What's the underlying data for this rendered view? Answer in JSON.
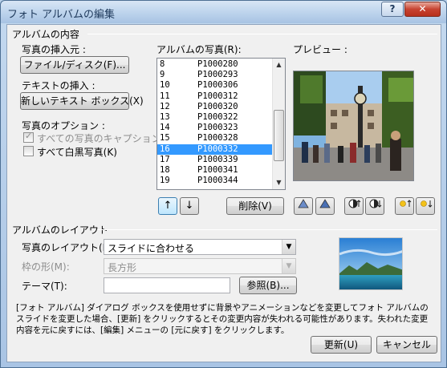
{
  "window": {
    "title": "フォト アルバムの編集"
  },
  "title_buttons": {
    "help": "?",
    "close": "✕"
  },
  "album_contents": {
    "group_label": "アルバムの内容",
    "insert_picture": {
      "label": "写真の挿入元 :",
      "button": "ファイル/ディスク(F)..."
    },
    "insert_text": {
      "label": "テキストの挿入 :",
      "button": "新しいテキスト ボックス(X)"
    },
    "options": {
      "label": "写真のオプション :",
      "captions": {
        "label": "すべての写真のキャプション(A)",
        "checked": true,
        "enabled": false
      },
      "bw": {
        "label": "すべて白黒写真(K)",
        "checked": false,
        "enabled": true
      }
    }
  },
  "pictures": {
    "label": "アルバムの写真(R):",
    "items": [
      {
        "num": "8",
        "name": "P1000280",
        "selected": false
      },
      {
        "num": "9",
        "name": "P1000293",
        "selected": false
      },
      {
        "num": "10",
        "name": "P1000306",
        "selected": false
      },
      {
        "num": "11",
        "name": "P1000312",
        "selected": false
      },
      {
        "num": "12",
        "name": "P1000320",
        "selected": false
      },
      {
        "num": "13",
        "name": "P1000322",
        "selected": false
      },
      {
        "num": "14",
        "name": "P1000323",
        "selected": false
      },
      {
        "num": "15",
        "name": "P1000328",
        "selected": false
      },
      {
        "num": "16",
        "name": "P1000332",
        "selected": true
      },
      {
        "num": "17",
        "name": "P1000339",
        "selected": false
      },
      {
        "num": "18",
        "name": "P1000341",
        "selected": false
      },
      {
        "num": "19",
        "name": "P1000344",
        "selected": false
      }
    ],
    "move_up": "↑",
    "move_down": "↓",
    "remove_button": "削除(V)"
  },
  "preview": {
    "label": "プレビュー :"
  },
  "image_tools": [
    "rotate-left-icon",
    "rotate-right-icon",
    "contrast-up-icon",
    "contrast-down-icon",
    "brightness-up-icon",
    "brightness-down-icon"
  ],
  "layout": {
    "group_label": "アルバムのレイアウト",
    "picture_layout": {
      "label": "写真のレイアウト(P):",
      "value": "スライドに合わせる"
    },
    "frame_shape": {
      "label": "枠の形(M):",
      "value": "長方形",
      "enabled": false
    },
    "theme": {
      "label": "テーマ(T):",
      "value": "",
      "browse_button": "参照(B)..."
    }
  },
  "note": "[フォト アルバム] ダイアログ ボックスを使用せずに背景やアニメーションなどを変更してフォト アルバムのスライドを変更した場合、[更新] をクリックするとその変更内容が失われる可能性があります。失われた変更内容を元に戻すには、[編集] メニューの [元に戻す] をクリックします。",
  "footer": {
    "update_button": "更新(U)",
    "cancel_button": "キャンセル"
  }
}
